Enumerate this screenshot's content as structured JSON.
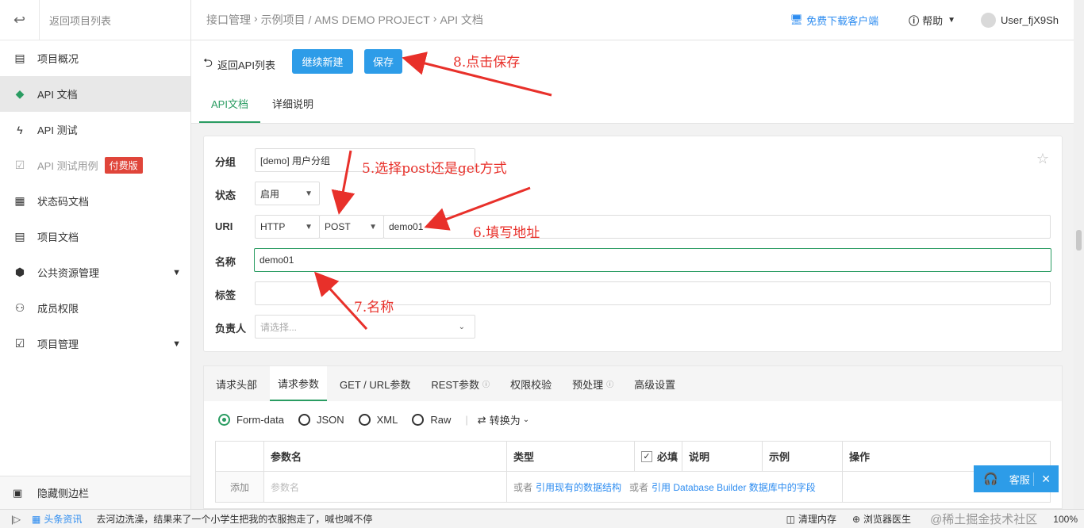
{
  "sidebar": {
    "back_label": "返回项目列表",
    "items": [
      {
        "label": "项目概况",
        "icon": "table-icon"
      },
      {
        "label": "API 文档",
        "icon": "doc-tag-icon"
      },
      {
        "label": "API 测试",
        "icon": "bolt-icon"
      },
      {
        "label": "API 测试用例",
        "icon": "clipboard-check-icon",
        "badge": "付费版"
      },
      {
        "label": "状态码文档",
        "icon": "code-doc-icon"
      },
      {
        "label": "项目文档",
        "icon": "list-doc-icon"
      },
      {
        "label": "公共资源管理",
        "icon": "cube-icon"
      },
      {
        "label": "成员权限",
        "icon": "user-icon"
      },
      {
        "label": "项目管理",
        "icon": "clipboard-icon"
      }
    ],
    "hide_label": "隐藏侧边栏"
  },
  "topbar": {
    "breadcrumb": [
      "接口管理",
      "示例项目 / AMS DEMO PROJECT",
      "API 文档"
    ],
    "download": "免费下载客户端",
    "help": "帮助",
    "user": "User_fjX9Sh"
  },
  "actions": {
    "back": "返回API列表",
    "continue_new": "继续新建",
    "save": "保存",
    "tabs": [
      "API文档",
      "详细说明"
    ]
  },
  "form": {
    "group_label": "分组",
    "group_value": "[demo] 用户分组",
    "status_label": "状态",
    "status_value": "启用",
    "uri_label": "URI",
    "protocol": "HTTP",
    "method": "POST",
    "uri_value": "demo01",
    "name_label": "名称",
    "name_value": "demo01",
    "tag_label": "标签",
    "owner_label": "负责人",
    "owner_placeholder": "请选择..."
  },
  "request": {
    "tabs": [
      "请求头部",
      "请求参数",
      "GET / URL参数",
      "REST参数",
      "权限校验",
      "预处理",
      "高级设置"
    ],
    "formats": [
      "Form-data",
      "JSON",
      "XML",
      "Raw"
    ],
    "convert": "转换为",
    "columns": [
      "参数名",
      "类型",
      "必填",
      "说明",
      "示例",
      "操作"
    ],
    "add_label": "添加",
    "param_placeholder": "参数名",
    "or1": "或者",
    "ref_struct": "引用现有的数据结构",
    "or2": "或者",
    "ref_db": "引用 Database Builder 数据库中的字段"
  },
  "kefu": "客服",
  "status_bar": {
    "news": "头条资讯",
    "headline": "去河边洗澡，结果来了一个小学生把我的衣服抱走了，喊也喊不停",
    "clean": "清理内存",
    "doctor": "浏览器医生",
    "zoom": "100%",
    "watermark": "@稀土掘金技术社区"
  },
  "annotations": {
    "a5": "5.选择post还是get方式",
    "a6": "6.填写地址",
    "a7": "7.名称",
    "a8": "8.点击保存"
  }
}
